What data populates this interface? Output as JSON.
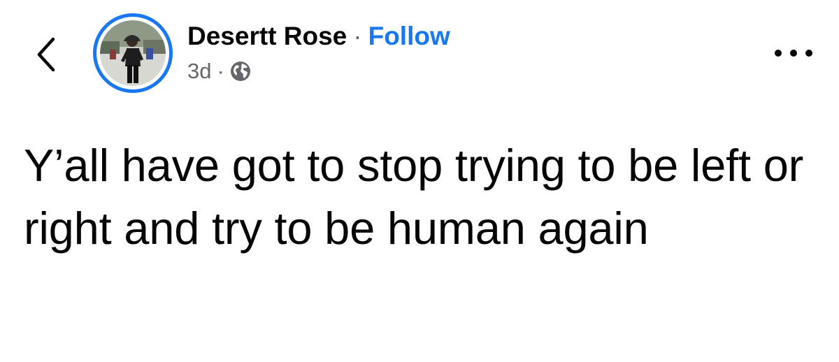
{
  "post": {
    "author_name": "Desertt Rose",
    "separator": "·",
    "follow_label": "Follow",
    "timestamp": "3d",
    "meta_separator": "·",
    "audience_icon": "globe-icon",
    "body_text": "Y’all have got to stop trying to be left or right and try to be human again"
  },
  "icons": {
    "back": "chevron-left-icon",
    "more": "more-horizontal-icon"
  },
  "colors": {
    "accent": "#1877f2",
    "text": "#050505",
    "secondary_text": "#65676b"
  }
}
